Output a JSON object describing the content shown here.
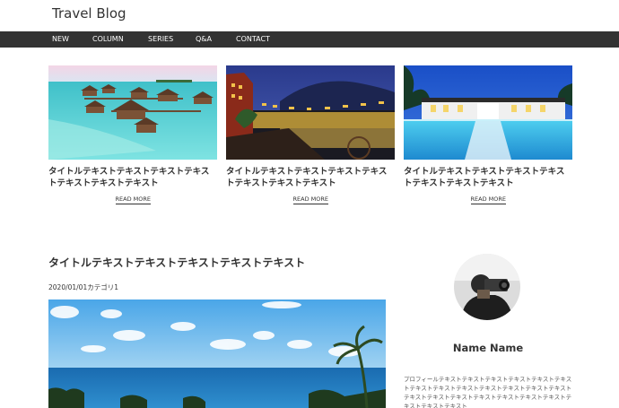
{
  "site": {
    "title": "Travel Blog"
  },
  "nav": {
    "items": [
      "NEW",
      "COLUMN",
      "SERIES",
      "Q&A",
      "CONTACT"
    ]
  },
  "cards": [
    {
      "title": "タイトルテキストテキストテキストテキストテキストテキストテキスト",
      "link": "READ MORE",
      "image": "overwater-bungalows-photo"
    },
    {
      "title": "タイトルテキストテキストテキストテキストテキストテキストテキスト",
      "link": "READ MORE",
      "image": "night-riverside-town-photo"
    },
    {
      "title": "タイトルテキストテキストテキストテキストテキストテキストテキスト",
      "link": "READ MORE",
      "image": "resort-pool-night-photo"
    }
  ],
  "post": {
    "title": "タイトルテキストテキストテキストテキストテキスト",
    "meta": "2020/01/01カテゴリ1",
    "image": "tropical-coast-photo"
  },
  "profile": {
    "name": "Name Name",
    "text": "プロフィールテキストテキストテキストテキストテキストテキストテキストテキストテキストテキストテキストテキストテキストテキストテキストテキストテキストテキストテキストテキストテキストテキストテキスト",
    "avatar": "photographer-avatar"
  }
}
